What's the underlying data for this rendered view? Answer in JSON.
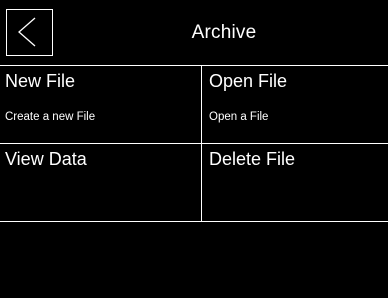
{
  "header": {
    "title": "Archive",
    "back_icon": "chevron-left-icon"
  },
  "menu": {
    "items": [
      {
        "title": "New File",
        "subtitle": "Create a new File"
      },
      {
        "title": "Open File",
        "subtitle": "Open a File"
      },
      {
        "title": "View Data",
        "subtitle": ""
      },
      {
        "title": "Delete File",
        "subtitle": ""
      }
    ]
  },
  "colors": {
    "background": "#000000",
    "foreground": "#ffffff"
  }
}
